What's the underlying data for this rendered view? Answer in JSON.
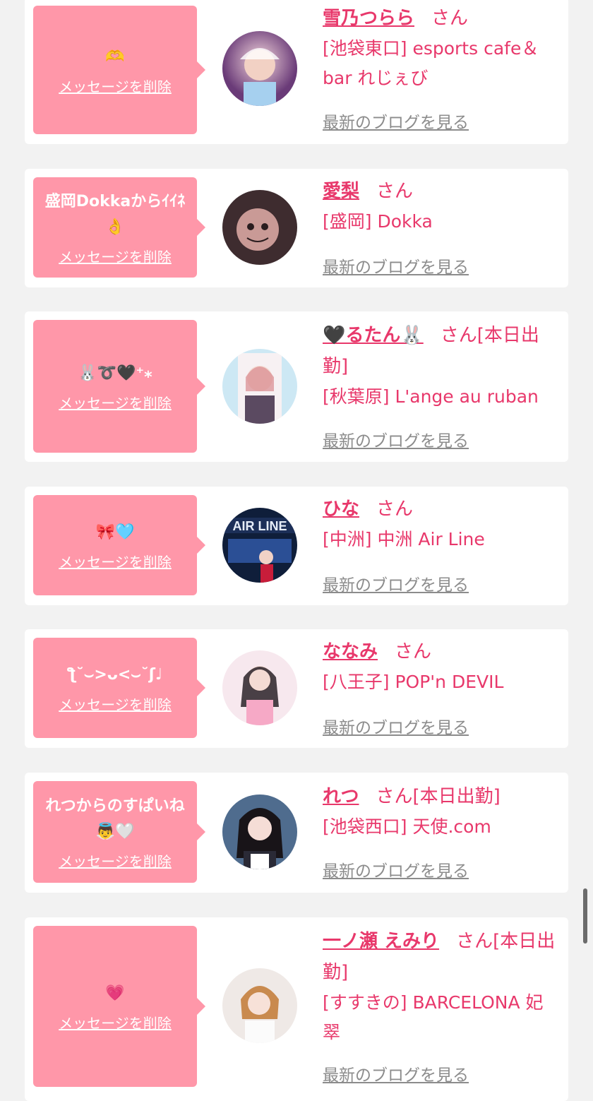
{
  "delete_label": "メッセージを削除",
  "blog_label": "最新のブログを見る",
  "san": "さん",
  "colors": {
    "bubble": "#ff97a9",
    "accent": "#e8386b",
    "link_gray": "#8c8c8c",
    "background": "#f2f2f2"
  },
  "items": [
    {
      "message": "🫶",
      "name": "雪乃つらら",
      "status": "",
      "shop": "[池袋東口] esports cafe＆bar れじぇび"
    },
    {
      "message": "盛岡Dokkaからｲｲﾈ👌",
      "name": "愛梨",
      "status": "",
      "shop": "[盛岡] Dokka"
    },
    {
      "message": "🐰➰🖤⁺⁎",
      "name": "🖤るたん🐰",
      "status": "[本日出勤]",
      "shop": "[秋葉原] L'ange au ruban"
    },
    {
      "message": "🎀🩵",
      "name": "ひな",
      "status": "",
      "shop": "[中洲] 中洲 Air Line"
    },
    {
      "message": "ƪ˘⌣>ᴗ<⌣˘ʃ♩",
      "name": "ななみ",
      "status": "",
      "shop": "[八王子] POP'n DEVIL"
    },
    {
      "message": "れつからのすぱいね👼🤍",
      "name": "れつ",
      "status": "[本日出勤]",
      "shop": "[池袋西口] 天使.com"
    },
    {
      "message": "💗",
      "name": "一ノ瀬 えみり",
      "status": "[本日出勤]",
      "shop": "[すすきの] BARCELONA 妃翠"
    }
  ]
}
